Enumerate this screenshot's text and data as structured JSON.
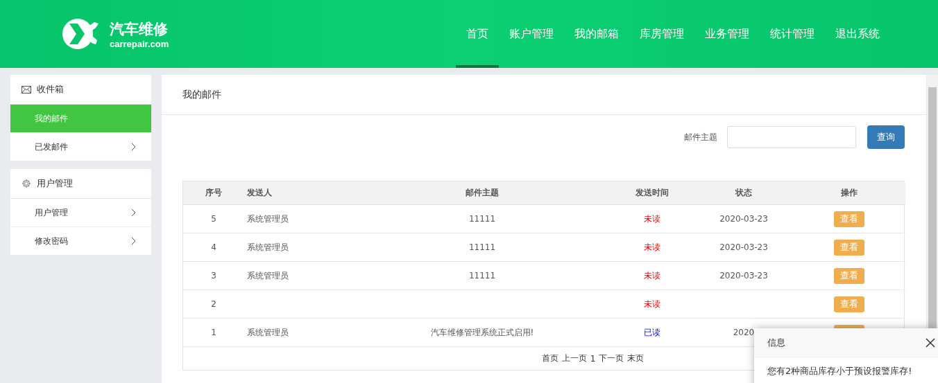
{
  "header": {
    "logo_title": "汽车维修",
    "logo_domain": "carrepair.com",
    "nav": [
      {
        "label": "首页",
        "selected": true
      },
      {
        "label": "账户管理",
        "selected": false
      },
      {
        "label": "我的邮箱",
        "selected": false
      },
      {
        "label": "库房管理",
        "selected": false
      },
      {
        "label": "业务管理",
        "selected": false
      },
      {
        "label": "统计管理",
        "selected": false
      },
      {
        "label": "退出系统",
        "selected": false
      }
    ]
  },
  "sidebar": {
    "groups": [
      {
        "title": "收件箱",
        "items": [
          {
            "label": "我的邮件",
            "selected": true
          },
          {
            "label": "已发邮件",
            "selected": false
          }
        ]
      },
      {
        "title": "用户管理",
        "items": [
          {
            "label": "用户管理",
            "selected": false
          },
          {
            "label": "修改密码",
            "selected": false
          }
        ]
      }
    ]
  },
  "main": {
    "title": "我的邮件",
    "search": {
      "label": "邮件主题",
      "button": "查询"
    },
    "table": {
      "columns": [
        "序号",
        "发送人",
        "邮件主题",
        "发送时间",
        "状态",
        "操作"
      ],
      "rows": [
        {
          "no": "5",
          "sender": "系统管理员",
          "subject": "11111",
          "status": "未读",
          "read": false,
          "date": "2020-03-23",
          "action": "查看"
        },
        {
          "no": "4",
          "sender": "系统管理员",
          "subject": "11111",
          "status": "未读",
          "read": false,
          "date": "2020-03-23",
          "action": "查看"
        },
        {
          "no": "3",
          "sender": "系统管理员",
          "subject": "11111",
          "status": "未读",
          "read": false,
          "date": "2020-03-23",
          "action": "查看"
        },
        {
          "no": "2",
          "status": "未读",
          "read": false,
          "action": "查看"
        },
        {
          "no": "1",
          "sender": "系统管理员",
          "subject": "汽车维修管理系统正式启用!",
          "status": "已读",
          "read": true,
          "date": "2020"
        }
      ]
    },
    "pagination": [
      "首页",
      "上一页",
      "1",
      "下一页",
      "末页"
    ]
  },
  "popup": {
    "title": "信息",
    "message": "您有2种商品库存小于预设报警库存!"
  }
}
